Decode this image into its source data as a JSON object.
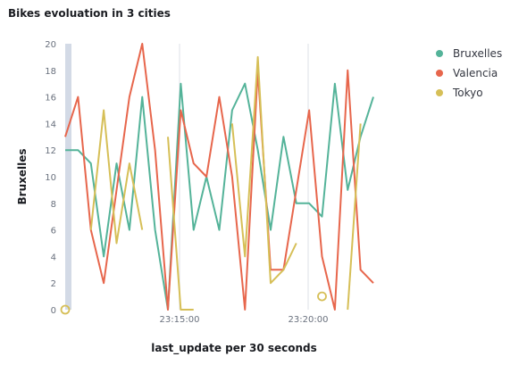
{
  "title": "Bikes evoluation in 3 cities",
  "chart_data": {
    "type": "line",
    "title": "Bikes evoluation in 3 cities",
    "xlabel": "last_update per 30 seconds",
    "ylabel": "Bruxelles",
    "x_ticks": [
      "23:15:00",
      "23:20:00"
    ],
    "y_ticks": [
      0,
      2,
      4,
      6,
      8,
      10,
      12,
      14,
      16,
      18,
      20
    ],
    "ylim": [
      0,
      20
    ],
    "grid": true,
    "legend_position": "right",
    "series": [
      {
        "name": "Bruxelles",
        "color": "#54b399",
        "points": [
          [
            0,
            12
          ],
          [
            1,
            12
          ],
          [
            2,
            11
          ],
          [
            3,
            4
          ],
          [
            4,
            11
          ],
          [
            5,
            6
          ],
          [
            6,
            16
          ],
          [
            7,
            6
          ],
          [
            8,
            0
          ],
          [
            9,
            17
          ],
          [
            10,
            6
          ],
          [
            11,
            10
          ],
          [
            12,
            6
          ],
          [
            13,
            15
          ],
          [
            14,
            17
          ],
          [
            15,
            12
          ],
          [
            16,
            6
          ],
          [
            17,
            13
          ],
          [
            18,
            8
          ],
          [
            19,
            8
          ],
          [
            20,
            7
          ],
          [
            21,
            17
          ],
          [
            22,
            9
          ],
          [
            23,
            13
          ],
          [
            24,
            16
          ]
        ]
      },
      {
        "name": "Valencia",
        "color": "#e7664c",
        "points": [
          [
            0,
            13
          ],
          [
            1,
            16
          ],
          [
            2,
            6
          ],
          [
            3,
            2
          ],
          [
            4,
            9
          ],
          [
            5,
            16
          ],
          [
            6,
            20
          ],
          [
            7,
            12
          ],
          [
            8,
            0
          ],
          [
            9,
            15
          ],
          [
            10,
            11
          ],
          [
            11,
            10
          ],
          [
            12,
            16
          ],
          [
            13,
            10
          ],
          [
            14,
            0
          ],
          [
            15,
            18
          ],
          [
            16,
            3
          ],
          [
            17,
            3
          ],
          [
            18,
            9
          ],
          [
            19,
            15
          ],
          [
            20,
            4
          ],
          [
            21,
            0
          ],
          [
            22,
            18
          ],
          [
            23,
            3
          ],
          [
            24,
            2
          ]
        ]
      },
      {
        "name": "Tokyo",
        "color": "#d6bf57",
        "segments": [
          [
            [
              0,
              0
            ]
          ],
          [
            [
              2,
              6
            ],
            [
              3,
              15
            ],
            [
              4,
              5
            ],
            [
              5,
              11
            ],
            [
              6,
              6
            ]
          ],
          [
            [
              8,
              13
            ],
            [
              9,
              0
            ],
            [
              10,
              0
            ]
          ],
          [
            [
              13,
              14
            ],
            [
              14,
              4
            ],
            [
              15,
              19
            ],
            [
              16,
              2
            ],
            [
              17,
              3
            ],
            [
              18,
              5
            ]
          ],
          [
            [
              20,
              1
            ]
          ],
          [
            [
              22,
              0
            ],
            [
              23,
              14
            ]
          ]
        ]
      }
    ]
  }
}
